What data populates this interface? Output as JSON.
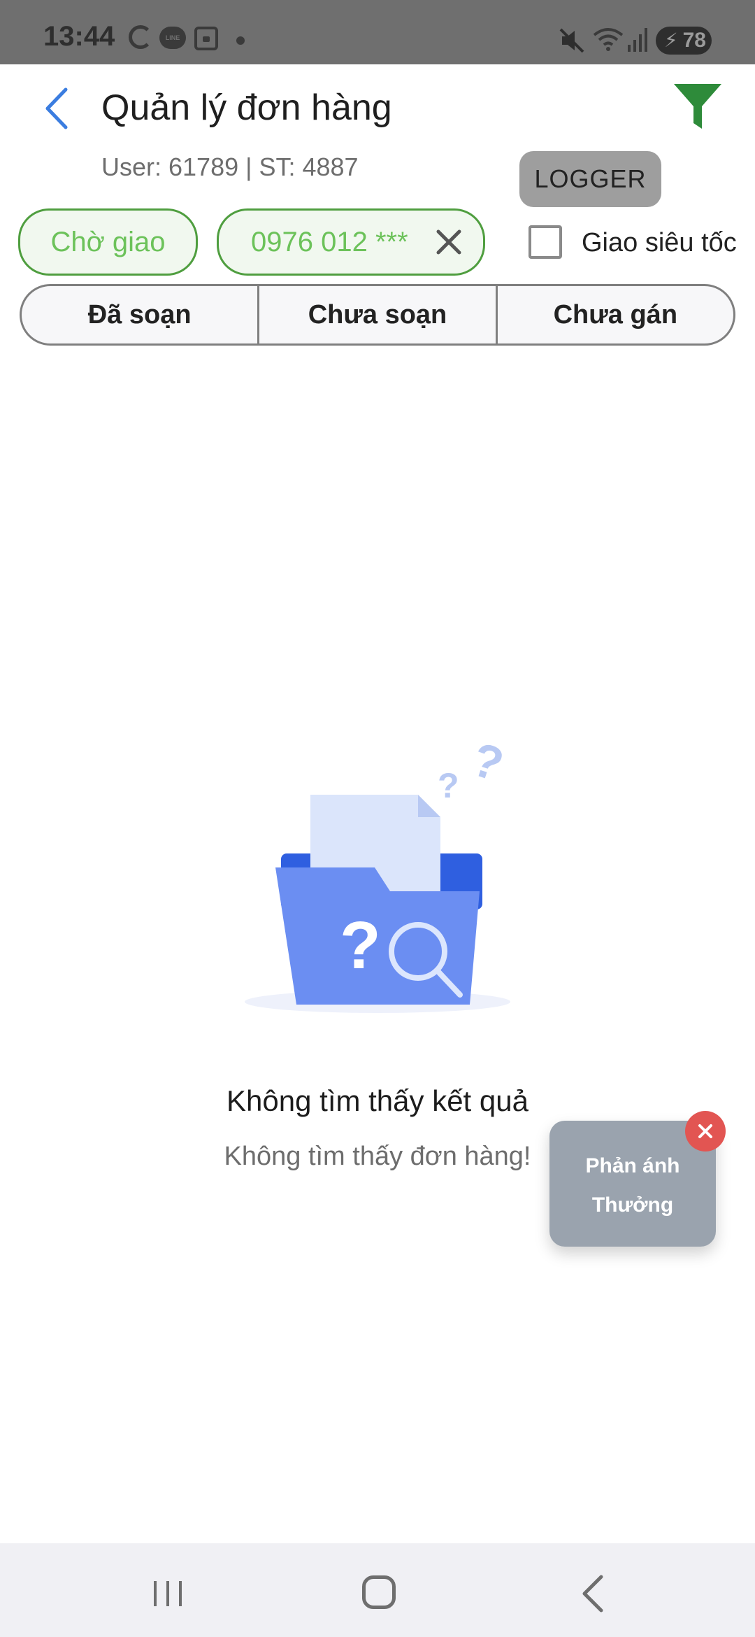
{
  "status_bar": {
    "time": "13:44",
    "battery": "78",
    "icons": [
      "google-icon",
      "line-app-icon",
      "screenshot-icon",
      "notification-dot-icon",
      "mute-icon",
      "wifi-icon",
      "signal-icon",
      "battery-icon"
    ]
  },
  "header": {
    "title": "Quản lý đơn hàng",
    "subtitle": "User: 61789 | ST: 4887",
    "logger_label": "LOGGER",
    "filter_color": "#2e8b3a"
  },
  "filters": {
    "status_chip": "Chờ giao",
    "phone_chip": "0976 012 ***",
    "express_label": "Giao siêu tốc",
    "express_checked": false
  },
  "tabs": [
    {
      "label": "Đã soạn"
    },
    {
      "label": "Chưa soạn"
    },
    {
      "label": "Chưa gán"
    }
  ],
  "empty_state": {
    "title": "Không tìm thấy kết quả",
    "message": "Không tìm thấy đơn hàng!"
  },
  "feedback": {
    "line1": "Phản ánh",
    "line2": "Thưởng"
  },
  "colors": {
    "accent_green": "#4f9e3f",
    "chip_text": "#6cc25a",
    "back_blue": "#3b7de0",
    "folder_blue": "#6b8ef2",
    "close_red": "#e25552"
  }
}
